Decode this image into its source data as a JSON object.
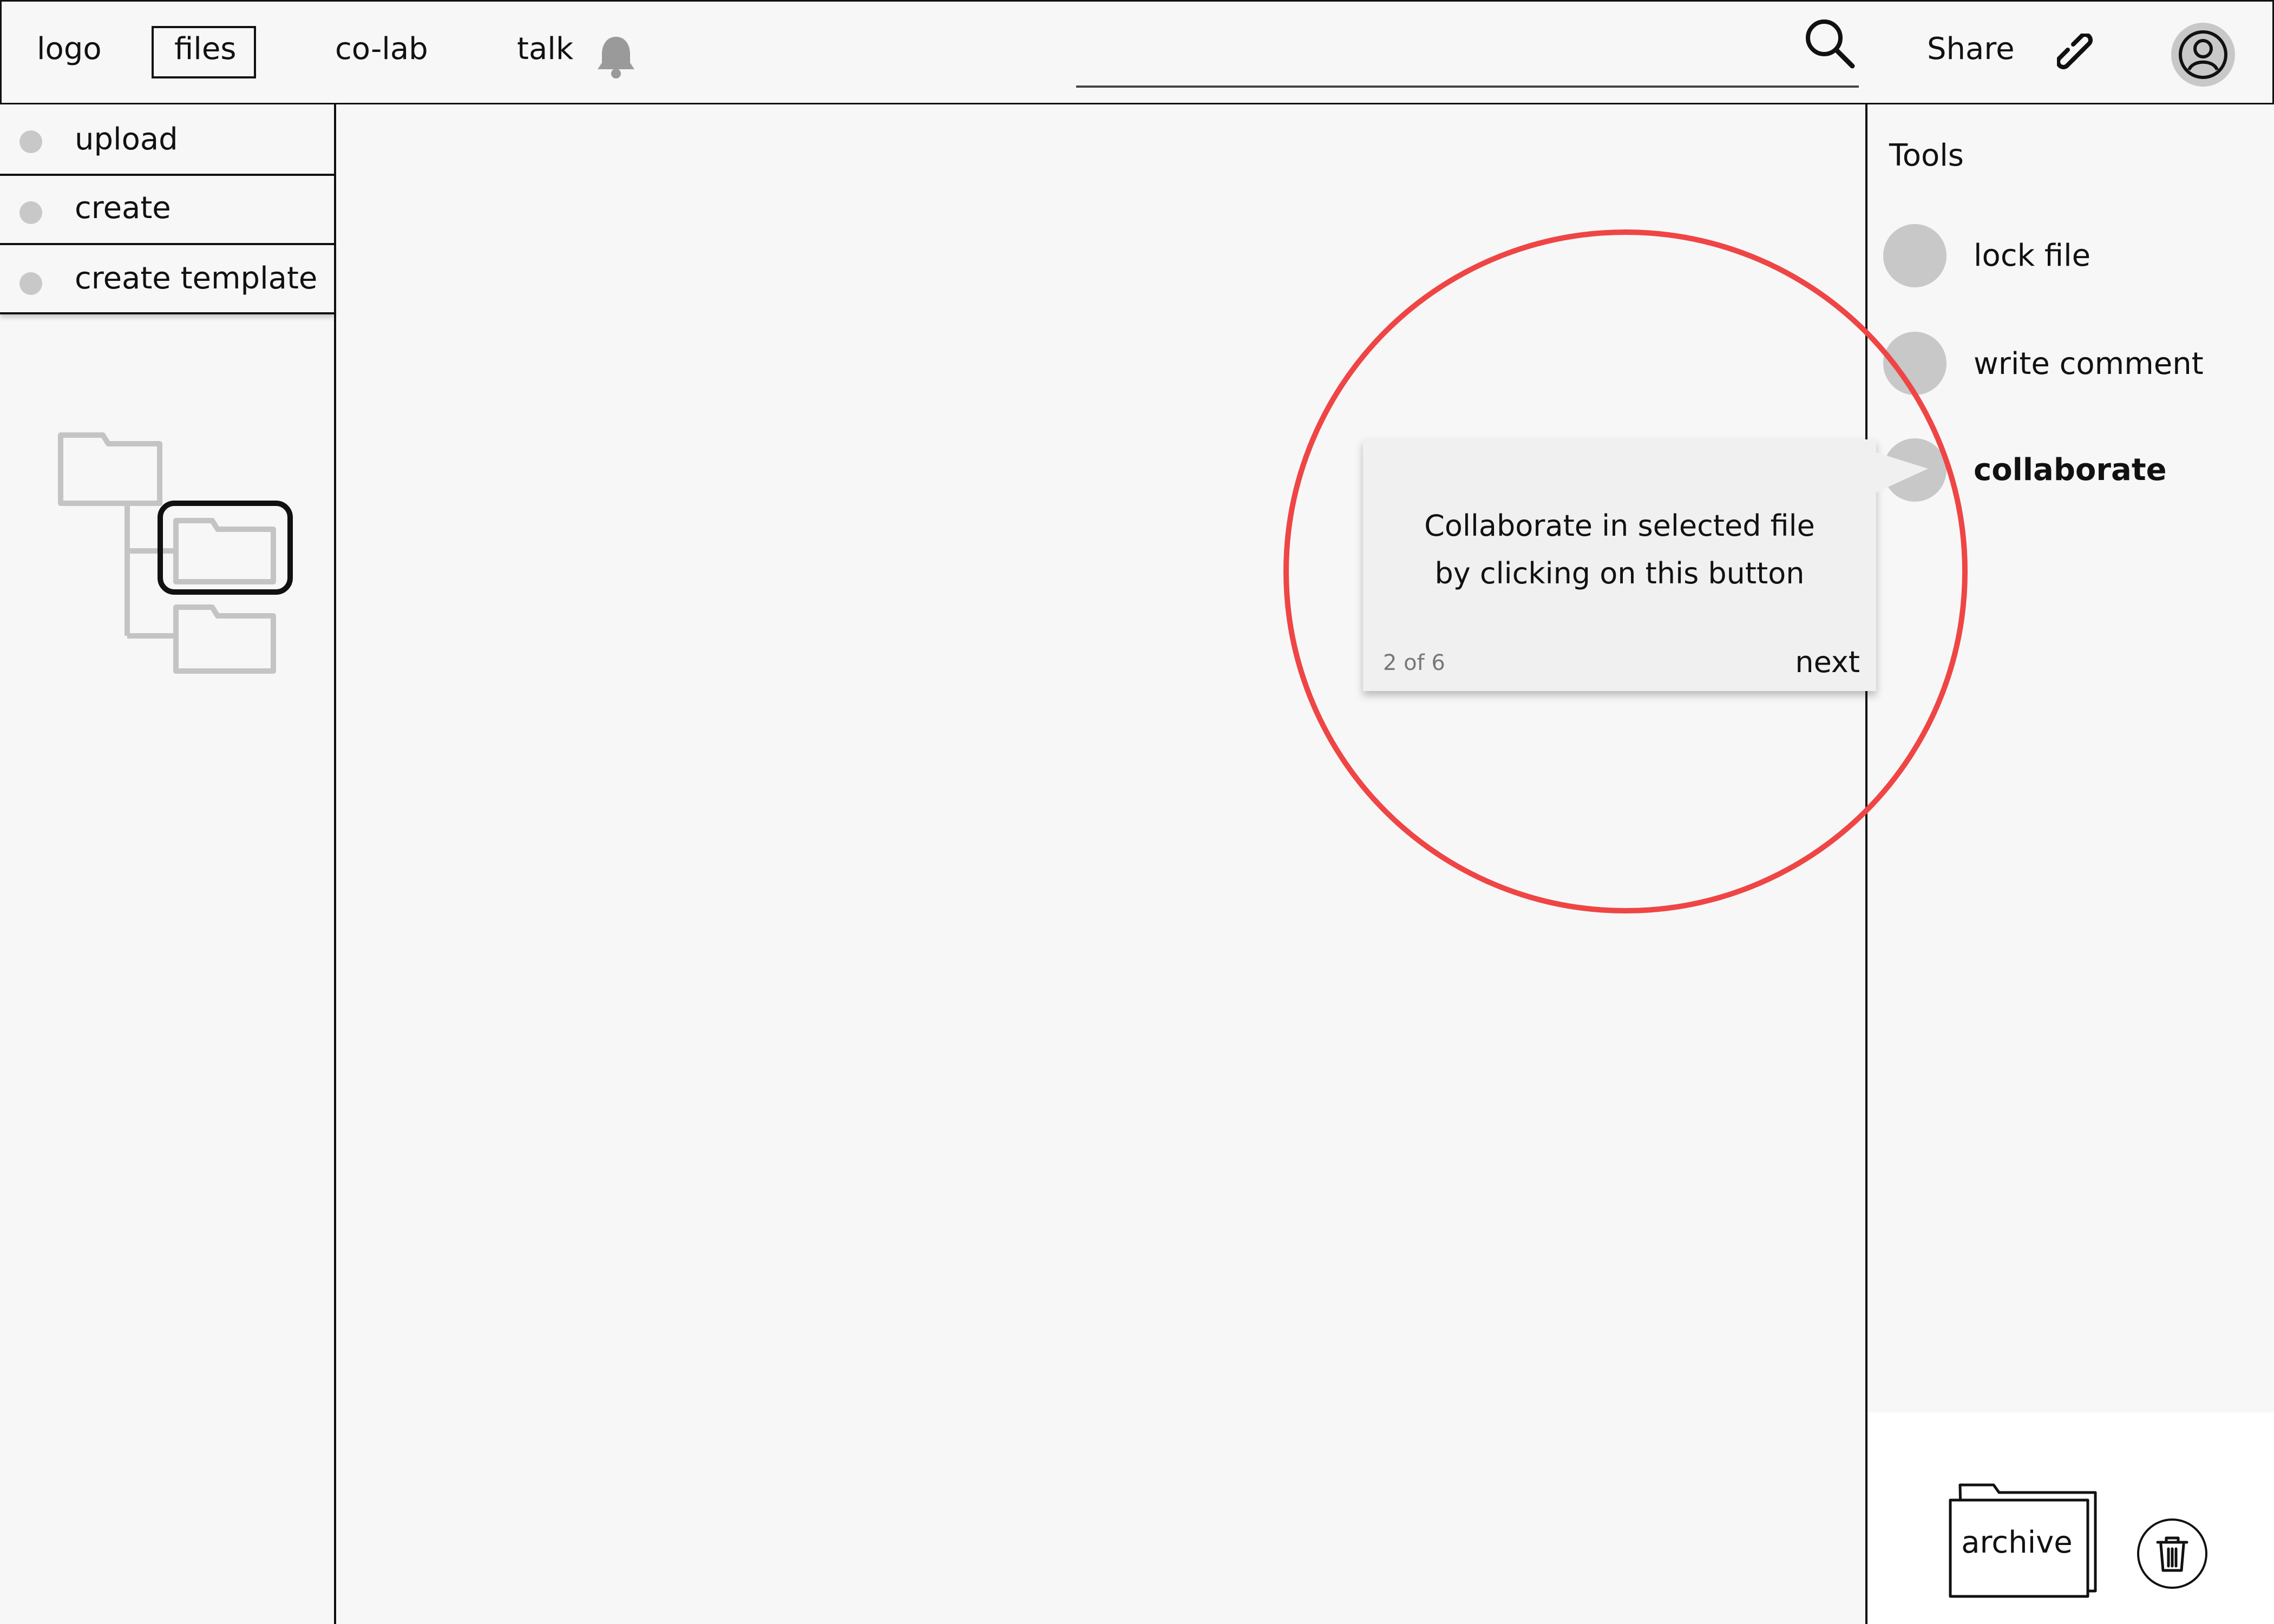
{
  "nav": {
    "logo": "logo",
    "items": [
      {
        "label": "files",
        "active": true
      },
      {
        "label": "co-lab",
        "active": false
      },
      {
        "label": "talk",
        "active": false
      }
    ],
    "share_label": "Share",
    "icons": [
      "bell-icon",
      "search-icon",
      "link-icon",
      "user-avatar-icon"
    ]
  },
  "sidebar": {
    "items": [
      {
        "label": "upload"
      },
      {
        "label": "create"
      },
      {
        "label": "create template"
      }
    ]
  },
  "tools": {
    "title": "Tools",
    "items": [
      {
        "label": "lock file",
        "bold": false
      },
      {
        "label": "write comment",
        "bold": false
      },
      {
        "label": "collaborate",
        "bold": true
      }
    ]
  },
  "tooltip": {
    "line1": "Collaborate in selected file",
    "line2": "by clicking on this button",
    "step": "2 of 6",
    "next": "next"
  },
  "bottom": {
    "archive_label": "archive",
    "icons": [
      "archive-folder-icon",
      "trash-icon"
    ]
  },
  "colors": {
    "highlight": "#ef4545",
    "placeholder_gray": "#c8c8c8",
    "background": "#f7f7f7"
  }
}
